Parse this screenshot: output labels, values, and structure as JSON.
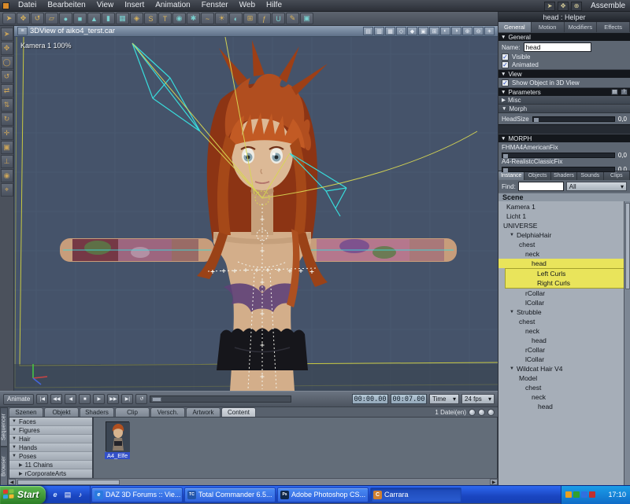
{
  "colors": {
    "ui_dark": "#3a3f47",
    "ui_mid": "#5d6672",
    "viewport_bg": "#45536a",
    "highlight_yellow": "#e9e45b",
    "taskbar_blue": "#1a45c0",
    "start_green": "#2c7e26",
    "wire_cyan": "#38dcdc",
    "wire_yellow": "#d8d752",
    "hair_orange": "#b14e1f",
    "skin": "#d3ae8a"
  },
  "menubar": {
    "items": [
      "Datei",
      "Bearbeiten",
      "View",
      "Insert",
      "Animation",
      "Fenster",
      "Web",
      "Hilfe"
    ],
    "mode_label": "Assemble"
  },
  "viewport": {
    "title": "3DView of aiko4_terst.car",
    "camera_label": "Kamera 1 100%"
  },
  "inspector": {
    "header": "head : Helper",
    "tabs": [
      "General",
      "Motion",
      "Modifiers",
      "Effects"
    ],
    "general_section": "General",
    "name_label": "Name:",
    "name_value": "head",
    "visible_label": "Visible",
    "animated_label": "Animated",
    "view_section": "View",
    "show_object_label": "Show Object in 3D View",
    "parameters_section": "Parameters",
    "misc_label": "Misc",
    "morph_label": "Morph",
    "headsize": {
      "label": "HeadSize",
      "value": "0,0"
    },
    "morph_section": "MORPH",
    "morphs": [
      {
        "label": "FHMA4AmericanFix",
        "value": "0,0"
      },
      {
        "label": "A4-RealistcClassicFix",
        "value": "0,0"
      }
    ],
    "browser_tabs": [
      "Instance",
      "Objects",
      "Shaders",
      "Sounds",
      "Clips"
    ],
    "find_label": "Find:",
    "find_filter": "All",
    "scene_label": "Scene",
    "tree": [
      {
        "label": "Kamera 1",
        "selected": false
      },
      {
        "label": "Licht 1",
        "selected": false
      },
      {
        "label": "UNIVERSE",
        "selected": false
      },
      {
        "label": "DelphiaHair",
        "selected": false
      },
      {
        "label": "chest",
        "selected": false
      },
      {
        "label": "neck",
        "selected": false
      },
      {
        "label": "head",
        "selected": true
      },
      {
        "label": "Left Curls",
        "selected": true
      },
      {
        "label": "Right Curls",
        "selected": true
      },
      {
        "label": "rCollar",
        "selected": false
      },
      {
        "label": "lCollar",
        "selected": false
      },
      {
        "label": "Strubble",
        "selected": false
      },
      {
        "label": "chest",
        "selected": false
      },
      {
        "label": "neck",
        "selected": false
      },
      {
        "label": "head",
        "selected": false
      },
      {
        "label": "rCollar",
        "selected": false
      },
      {
        "label": "lCollar",
        "selected": false
      },
      {
        "label": "Wildcat Hair V4",
        "selected": false
      },
      {
        "label": "Model",
        "selected": false
      },
      {
        "label": "chest",
        "selected": false
      },
      {
        "label": "neck",
        "selected": false
      },
      {
        "label": "head",
        "selected": false
      }
    ]
  },
  "timeline": {
    "animate_label": "Animate",
    "time_current": "00:00.00",
    "time_end": "00:07.00",
    "mode_label": "Time",
    "fps_label": "24 fps"
  },
  "bottom": {
    "tabs": [
      "Szenen",
      "Objekt",
      "Shaders",
      "Clip",
      "Versch.",
      "Artwork",
      "Content"
    ],
    "active_tab": "Content",
    "file_count": "1 Datei(en)",
    "side_tabs": [
      "Sequencer",
      "Browser"
    ],
    "folders": [
      "Faces",
      "Figures",
      "Hair",
      "Hands",
      "Poses",
      "11 Chains",
      "rCorporateArts"
    ],
    "thumb_label": "A4_Elfe"
  },
  "taskbar": {
    "start_label": "Start",
    "quick_launch": [
      "e",
      "▤",
      "♪"
    ],
    "buttons": [
      {
        "label": "DAZ 3D Forums :: Vie...",
        "icon": "e"
      },
      {
        "label": "Total Commander 6.5...",
        "icon": "TC"
      },
      {
        "label": "Adobe Photoshop CS...",
        "icon": "Ps"
      },
      {
        "label": "Carrara",
        "icon": "C"
      }
    ],
    "clock": "17:10"
  },
  "icons": {
    "collapse_down": "▼",
    "collapse_right": "▶",
    "dropdown": "▾",
    "check": "✓",
    "param_buttons": [
      "▤",
      "?"
    ],
    "menubar_tools": [
      {
        "name": "pointer-mode-icon",
        "glyph": "➤"
      },
      {
        "name": "hand-mode-icon",
        "glyph": "✥"
      },
      {
        "name": "helper-mode-icon",
        "glyph": "⊕"
      }
    ],
    "toolbar": [
      {
        "name": "select-tool-icon",
        "glyph": "➤"
      },
      {
        "name": "move-tool-icon",
        "glyph": "✥"
      },
      {
        "name": "rotate-tool-icon",
        "glyph": "↺"
      },
      {
        "name": "scale-tool-icon",
        "glyph": "▱"
      },
      {
        "name": "sphere-primitive-icon",
        "glyph": "●"
      },
      {
        "name": "cube-primitive-icon",
        "glyph": "■"
      },
      {
        "name": "cone-primitive-icon",
        "glyph": "▲"
      },
      {
        "name": "cylinder-primitive-icon",
        "glyph": "▮"
      },
      {
        "name": "plane-primitive-icon",
        "glyph": "▦"
      },
      {
        "name": "vertex-object-icon",
        "glyph": "◈"
      },
      {
        "name": "spline-object-icon",
        "glyph": "S"
      },
      {
        "name": "text-object-icon",
        "glyph": "T"
      },
      {
        "name": "metaball-icon",
        "glyph": "◉"
      },
      {
        "name": "particle-emitter-icon",
        "glyph": "✱"
      },
      {
        "name": "hair-object-icon",
        "glyph": "~"
      },
      {
        "name": "light-icon",
        "glyph": "☀"
      },
      {
        "name": "camera-icon",
        "glyph": "◐"
      },
      {
        "name": "group-icon",
        "glyph": "⊞"
      },
      {
        "name": "modifier-icon",
        "glyph": "ƒ"
      },
      {
        "name": "magnet-icon",
        "glyph": "U"
      },
      {
        "name": "paint-icon",
        "glyph": "✎"
      },
      {
        "name": "render-icon",
        "glyph": "▣"
      }
    ],
    "left_tools": [
      {
        "name": "pointer-tool-icon",
        "glyph": "➤"
      },
      {
        "name": "hand-tool-icon",
        "glyph": "✥"
      },
      {
        "name": "zoom-tool-icon",
        "glyph": "◯"
      },
      {
        "name": "orbit-tool-icon",
        "glyph": "↺"
      },
      {
        "name": "pan-tool-icon",
        "glyph": "⇄"
      },
      {
        "name": "dolly-tool-icon",
        "glyph": "⇅"
      },
      {
        "name": "bank-tool-icon",
        "glyph": "↻"
      },
      {
        "name": "track-tool-icon",
        "glyph": "✛"
      },
      {
        "name": "frame-tool-icon",
        "glyph": "▣"
      },
      {
        "name": "axis-tool-icon",
        "glyph": "⊥"
      },
      {
        "name": "eye-tool-icon",
        "glyph": "◉"
      },
      {
        "name": "target-tool-icon",
        "glyph": "⌖"
      }
    ],
    "viewport_modes": [
      {
        "name": "menu-icon",
        "glyph": "≡"
      },
      {
        "name": "single-view-icon",
        "glyph": "▤"
      },
      {
        "name": "split-view-icon",
        "glyph": "▥"
      },
      {
        "name": "quad-view-icon",
        "glyph": "▦"
      },
      {
        "name": "wireframe-mode-icon",
        "glyph": "◇"
      },
      {
        "name": "shaded-mode-icon",
        "glyph": "◆"
      },
      {
        "name": "textured-mode-icon",
        "glyph": "▣"
      },
      {
        "name": "grid-toggle-icon",
        "glyph": "⊞"
      }
    ],
    "viewport_controls": [
      {
        "name": "camera-view-icon",
        "glyph": "◐"
      },
      {
        "name": "light-view-icon",
        "glyph": "◑"
      },
      {
        "name": "zoom-in-icon",
        "glyph": "⊕"
      },
      {
        "name": "zoom-out-icon",
        "glyph": "⊖"
      },
      {
        "name": "render-preview-icon",
        "glyph": "☀"
      }
    ],
    "transport": [
      {
        "name": "go-start-button",
        "glyph": "|◀"
      },
      {
        "name": "fast-backward-button",
        "glyph": "◀◀"
      },
      {
        "name": "play-backward-button",
        "glyph": "◀"
      },
      {
        "name": "stop-button",
        "glyph": "■"
      },
      {
        "name": "play-button",
        "glyph": "▶"
      },
      {
        "name": "fast-forward-button",
        "glyph": "▶▶"
      },
      {
        "name": "go-end-button",
        "glyph": "▶|"
      },
      {
        "name": "loop-button",
        "glyph": "↺"
      }
    ],
    "thumb_buttons": [
      "○",
      "◎",
      "●"
    ]
  }
}
